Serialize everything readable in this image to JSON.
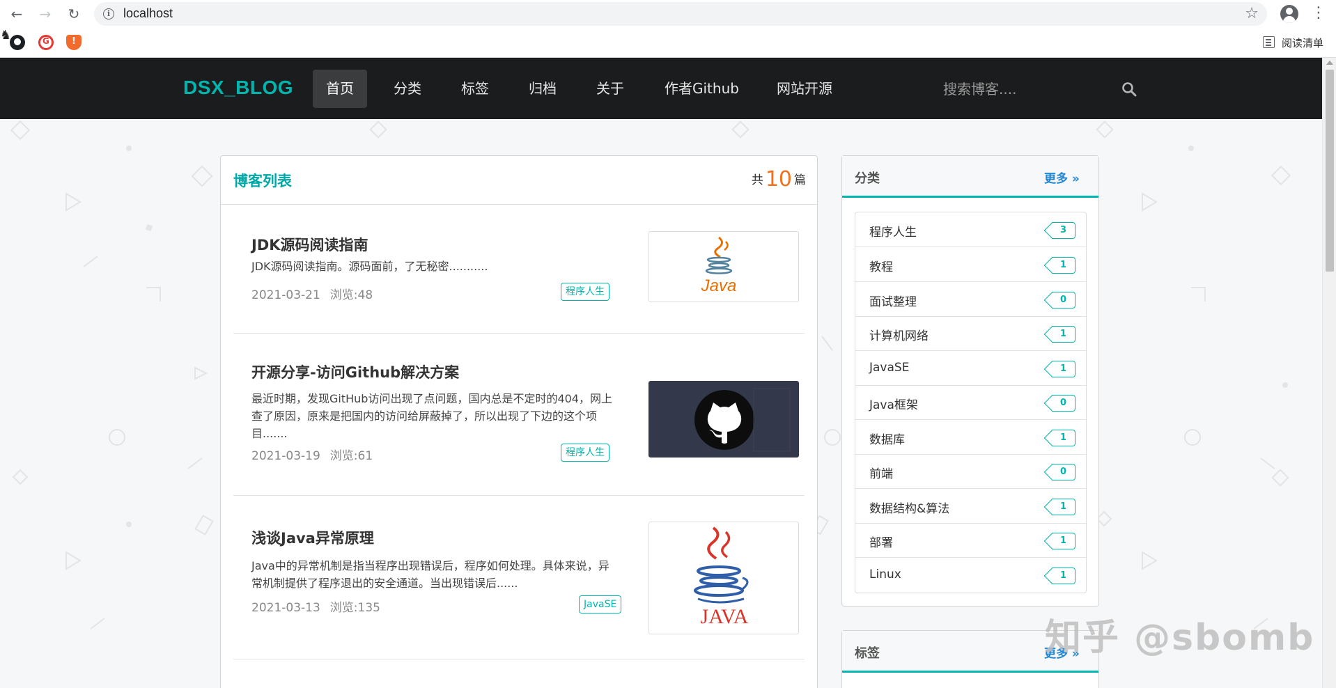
{
  "browser": {
    "url": "localhost",
    "reading_list_label": "阅读清单"
  },
  "nav": {
    "logo": "DSX_BLOG",
    "items": [
      {
        "label": "首页",
        "active": true
      },
      {
        "label": "分类"
      },
      {
        "label": "标签"
      },
      {
        "label": "归档"
      },
      {
        "label": "关于"
      },
      {
        "label": "作者Github"
      },
      {
        "label": "网站开源"
      }
    ],
    "search_placeholder": "搜索博客...."
  },
  "blog_list": {
    "title": "博客列表",
    "count_prefix": "共",
    "count": "10",
    "count_suffix": "篇",
    "posts": [
      {
        "title": "JDK源码阅读指南",
        "desc": "JDK源码阅读指南。源码面前，了无秘密...........",
        "date": "2021-03-21",
        "views": "浏览:48",
        "tag": "程序人生",
        "thumb_text": "Java"
      },
      {
        "title": "开源分享-访问Github解决方案",
        "desc": "最近时期，发现GitHub访问出现了点问题，国内总是不定时的404，网上查了原因，原来是把国内的访问给屏蔽掉了，所以出现了下边的这个项目.......",
        "date": "2021-03-19",
        "views": "浏览:61",
        "tag": "程序人生",
        "thumb_text": ""
      },
      {
        "title": "浅谈Java异常原理",
        "desc": "Java中的异常机制是指当程序出现错误后，程序如何处理。具体来说，异常机制提供了程序退出的安全通道。当出现错误后......",
        "date": "2021-03-13",
        "views": "浏览:135",
        "tag": "JavaSE",
        "thumb_text": "JAVA"
      }
    ]
  },
  "categories": {
    "title": "分类",
    "more": "更多 »",
    "items": [
      {
        "name": "程序人生",
        "count": "3"
      },
      {
        "name": "教程",
        "count": "1"
      },
      {
        "name": "面试整理",
        "count": "0"
      },
      {
        "name": "计算机网络",
        "count": "1"
      },
      {
        "name": "JavaSE",
        "count": "1"
      },
      {
        "name": "Java框架",
        "count": "0"
      },
      {
        "name": "数据库",
        "count": "1"
      },
      {
        "name": "前端",
        "count": "0"
      },
      {
        "name": "数据结构&算法",
        "count": "1"
      },
      {
        "name": "部署",
        "count": "1"
      },
      {
        "name": "Linux",
        "count": "1"
      }
    ]
  },
  "tags": {
    "title": "标签",
    "more": "更多 »"
  },
  "watermark": "知乎 @sbomb",
  "colors": {
    "accent": "#00b5ad",
    "link": "#2185d0",
    "count": "#f2711c",
    "navbar": "#1b1c1d"
  }
}
